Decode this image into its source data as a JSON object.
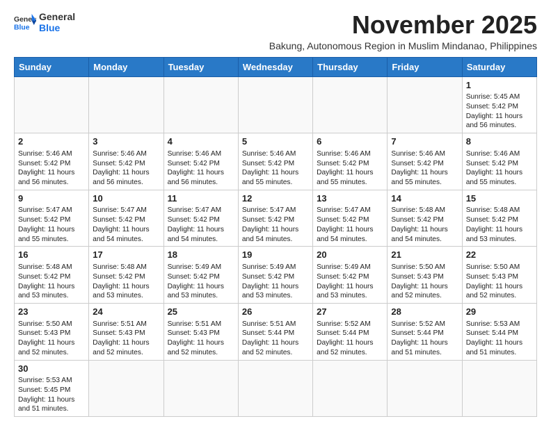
{
  "logo": {
    "general": "General",
    "blue": "Blue"
  },
  "header": {
    "month_title": "November 2025",
    "subtitle": "Bakung, Autonomous Region in Muslim Mindanao, Philippines"
  },
  "weekdays": [
    "Sunday",
    "Monday",
    "Tuesday",
    "Wednesday",
    "Thursday",
    "Friday",
    "Saturday"
  ],
  "weeks": [
    [
      {
        "day": "",
        "info": ""
      },
      {
        "day": "",
        "info": ""
      },
      {
        "day": "",
        "info": ""
      },
      {
        "day": "",
        "info": ""
      },
      {
        "day": "",
        "info": ""
      },
      {
        "day": "",
        "info": ""
      },
      {
        "day": "1",
        "info": "Sunrise: 5:45 AM\nSunset: 5:42 PM\nDaylight: 11 hours\nand 56 minutes."
      }
    ],
    [
      {
        "day": "2",
        "info": "Sunrise: 5:46 AM\nSunset: 5:42 PM\nDaylight: 11 hours\nand 56 minutes."
      },
      {
        "day": "3",
        "info": "Sunrise: 5:46 AM\nSunset: 5:42 PM\nDaylight: 11 hours\nand 56 minutes."
      },
      {
        "day": "4",
        "info": "Sunrise: 5:46 AM\nSunset: 5:42 PM\nDaylight: 11 hours\nand 56 minutes."
      },
      {
        "day": "5",
        "info": "Sunrise: 5:46 AM\nSunset: 5:42 PM\nDaylight: 11 hours\nand 55 minutes."
      },
      {
        "day": "6",
        "info": "Sunrise: 5:46 AM\nSunset: 5:42 PM\nDaylight: 11 hours\nand 55 minutes."
      },
      {
        "day": "7",
        "info": "Sunrise: 5:46 AM\nSunset: 5:42 PM\nDaylight: 11 hours\nand 55 minutes."
      },
      {
        "day": "8",
        "info": "Sunrise: 5:46 AM\nSunset: 5:42 PM\nDaylight: 11 hours\nand 55 minutes."
      }
    ],
    [
      {
        "day": "9",
        "info": "Sunrise: 5:47 AM\nSunset: 5:42 PM\nDaylight: 11 hours\nand 55 minutes."
      },
      {
        "day": "10",
        "info": "Sunrise: 5:47 AM\nSunset: 5:42 PM\nDaylight: 11 hours\nand 54 minutes."
      },
      {
        "day": "11",
        "info": "Sunrise: 5:47 AM\nSunset: 5:42 PM\nDaylight: 11 hours\nand 54 minutes."
      },
      {
        "day": "12",
        "info": "Sunrise: 5:47 AM\nSunset: 5:42 PM\nDaylight: 11 hours\nand 54 minutes."
      },
      {
        "day": "13",
        "info": "Sunrise: 5:47 AM\nSunset: 5:42 PM\nDaylight: 11 hours\nand 54 minutes."
      },
      {
        "day": "14",
        "info": "Sunrise: 5:48 AM\nSunset: 5:42 PM\nDaylight: 11 hours\nand 54 minutes."
      },
      {
        "day": "15",
        "info": "Sunrise: 5:48 AM\nSunset: 5:42 PM\nDaylight: 11 hours\nand 53 minutes."
      }
    ],
    [
      {
        "day": "16",
        "info": "Sunrise: 5:48 AM\nSunset: 5:42 PM\nDaylight: 11 hours\nand 53 minutes."
      },
      {
        "day": "17",
        "info": "Sunrise: 5:48 AM\nSunset: 5:42 PM\nDaylight: 11 hours\nand 53 minutes."
      },
      {
        "day": "18",
        "info": "Sunrise: 5:49 AM\nSunset: 5:42 PM\nDaylight: 11 hours\nand 53 minutes."
      },
      {
        "day": "19",
        "info": "Sunrise: 5:49 AM\nSunset: 5:42 PM\nDaylight: 11 hours\nand 53 minutes."
      },
      {
        "day": "20",
        "info": "Sunrise: 5:49 AM\nSunset: 5:42 PM\nDaylight: 11 hours\nand 53 minutes."
      },
      {
        "day": "21",
        "info": "Sunrise: 5:50 AM\nSunset: 5:43 PM\nDaylight: 11 hours\nand 52 minutes."
      },
      {
        "day": "22",
        "info": "Sunrise: 5:50 AM\nSunset: 5:43 PM\nDaylight: 11 hours\nand 52 minutes."
      }
    ],
    [
      {
        "day": "23",
        "info": "Sunrise: 5:50 AM\nSunset: 5:43 PM\nDaylight: 11 hours\nand 52 minutes."
      },
      {
        "day": "24",
        "info": "Sunrise: 5:51 AM\nSunset: 5:43 PM\nDaylight: 11 hours\nand 52 minutes."
      },
      {
        "day": "25",
        "info": "Sunrise: 5:51 AM\nSunset: 5:43 PM\nDaylight: 11 hours\nand 52 minutes."
      },
      {
        "day": "26",
        "info": "Sunrise: 5:51 AM\nSunset: 5:44 PM\nDaylight: 11 hours\nand 52 minutes."
      },
      {
        "day": "27",
        "info": "Sunrise: 5:52 AM\nSunset: 5:44 PM\nDaylight: 11 hours\nand 52 minutes."
      },
      {
        "day": "28",
        "info": "Sunrise: 5:52 AM\nSunset: 5:44 PM\nDaylight: 11 hours\nand 51 minutes."
      },
      {
        "day": "29",
        "info": "Sunrise: 5:53 AM\nSunset: 5:44 PM\nDaylight: 11 hours\nand 51 minutes."
      }
    ],
    [
      {
        "day": "30",
        "info": "Sunrise: 5:53 AM\nSunset: 5:45 PM\nDaylight: 11 hours\nand 51 minutes."
      },
      {
        "day": "",
        "info": ""
      },
      {
        "day": "",
        "info": ""
      },
      {
        "day": "",
        "info": ""
      },
      {
        "day": "",
        "info": ""
      },
      {
        "day": "",
        "info": ""
      },
      {
        "day": "",
        "info": ""
      }
    ]
  ]
}
